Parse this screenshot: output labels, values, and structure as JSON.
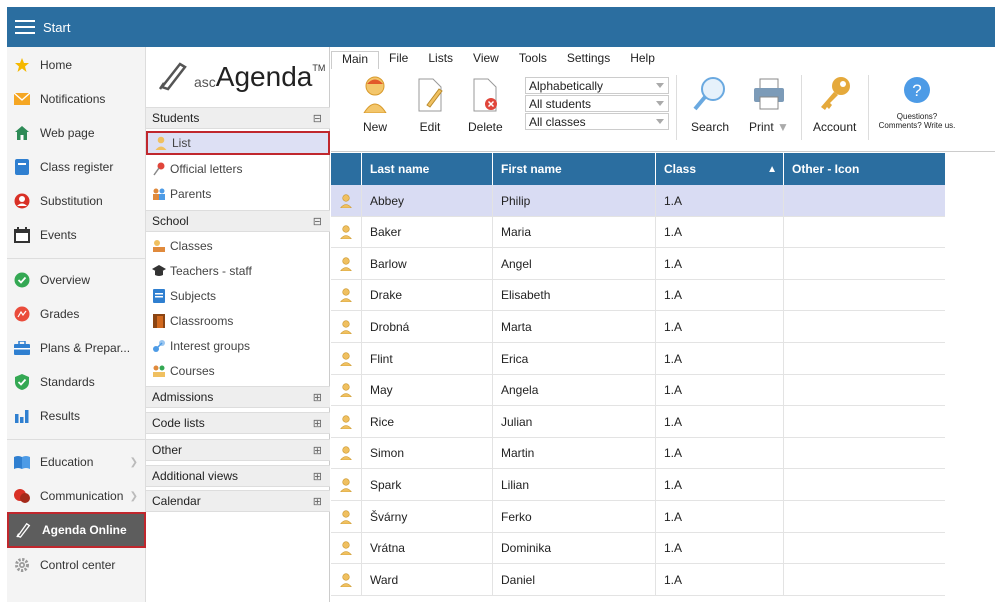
{
  "topbar": {
    "title": "Start"
  },
  "leftnav": {
    "items": [
      {
        "label": "Home",
        "icon": "star-icon"
      },
      {
        "label": "Notifications",
        "icon": "envelope-icon"
      },
      {
        "label": "Web page",
        "icon": "house-icon"
      },
      {
        "label": "Class register",
        "icon": "register-icon"
      },
      {
        "label": "Substitution",
        "icon": "substitution-icon"
      },
      {
        "label": "Events",
        "icon": "calendar-icon"
      },
      {
        "label": "Overview",
        "icon": "check-circle-icon"
      },
      {
        "label": "Grades",
        "icon": "grades-icon"
      },
      {
        "label": "Plans & Prepar...",
        "icon": "plans-icon"
      },
      {
        "label": "Standards",
        "icon": "shield-check-icon"
      },
      {
        "label": "Results",
        "icon": "bar-chart-icon"
      },
      {
        "label": "Education",
        "icon": "book-icon"
      },
      {
        "label": "Communication",
        "icon": "chat-icon"
      },
      {
        "label": "Agenda Online",
        "icon": "agenda-icon"
      },
      {
        "label": "Control center",
        "icon": "gear-icon"
      }
    ]
  },
  "subnav": {
    "logo": {
      "asc": "asc",
      "agenda": "Agenda",
      "tm": "TM"
    },
    "students": {
      "header": "Students",
      "toggle": "⊟",
      "items": [
        "List",
        "Official letters",
        "Parents"
      ]
    },
    "school": {
      "header": "School",
      "toggle": "⊟",
      "items": [
        "Classes",
        "Teachers - staff",
        "Subjects",
        "Classrooms",
        "Interest groups",
        "Courses"
      ]
    },
    "collapsed": [
      {
        "header": "Admissions",
        "toggle": "⊞"
      },
      {
        "header": "Code lists",
        "toggle": "⊞"
      },
      {
        "header": "Other",
        "toggle": "⊞"
      },
      {
        "header": "Additional views",
        "toggle": "⊞"
      },
      {
        "header": "Calendar",
        "toggle": "⊞"
      }
    ]
  },
  "ribbon": {
    "menu": [
      "Main",
      "File",
      "Lists",
      "View",
      "Tools",
      "Settings",
      "Help"
    ],
    "new": "New",
    "edit": "Edit",
    "delete": "Delete",
    "combos": [
      "Alphabetically",
      "All students",
      "All classes"
    ],
    "search": "Search",
    "print": "Print",
    "account": "Account",
    "questions": "Questions? Comments? Write us.",
    "help_glyph": "?"
  },
  "grid": {
    "columns": [
      "Last name",
      "First name",
      "Class",
      "Other - Icon"
    ],
    "sort_indicator": "▲",
    "rows": [
      {
        "last": "Abbey",
        "first": "Philip",
        "cls": "1.A"
      },
      {
        "last": "Baker",
        "first": "Maria",
        "cls": "1.A"
      },
      {
        "last": "Barlow",
        "first": "Angel",
        "cls": "1.A"
      },
      {
        "last": "Drake",
        "first": "Elisabeth",
        "cls": "1.A"
      },
      {
        "last": "Drobná",
        "first": "Marta",
        "cls": "1.A"
      },
      {
        "last": "Flint",
        "first": "Erica",
        "cls": "1.A"
      },
      {
        "last": "May",
        "first": "Angela",
        "cls": "1.A"
      },
      {
        "last": "Rice",
        "first": "Julian",
        "cls": "1.A"
      },
      {
        "last": "Simon",
        "first": "Martin",
        "cls": "1.A"
      },
      {
        "last": "Spark",
        "first": "Lilian",
        "cls": "1.A"
      },
      {
        "last": "Švárny",
        "first": "Ferko",
        "cls": "1.A"
      },
      {
        "last": "Vrátna",
        "first": "Dominika",
        "cls": "1.A"
      },
      {
        "last": "Ward",
        "first": "Daniel",
        "cls": "1.A"
      }
    ]
  },
  "colors": {
    "header_blue": "#2b6ea0",
    "selection": "#d9dcf3",
    "highlight_border": "#c0272d"
  }
}
